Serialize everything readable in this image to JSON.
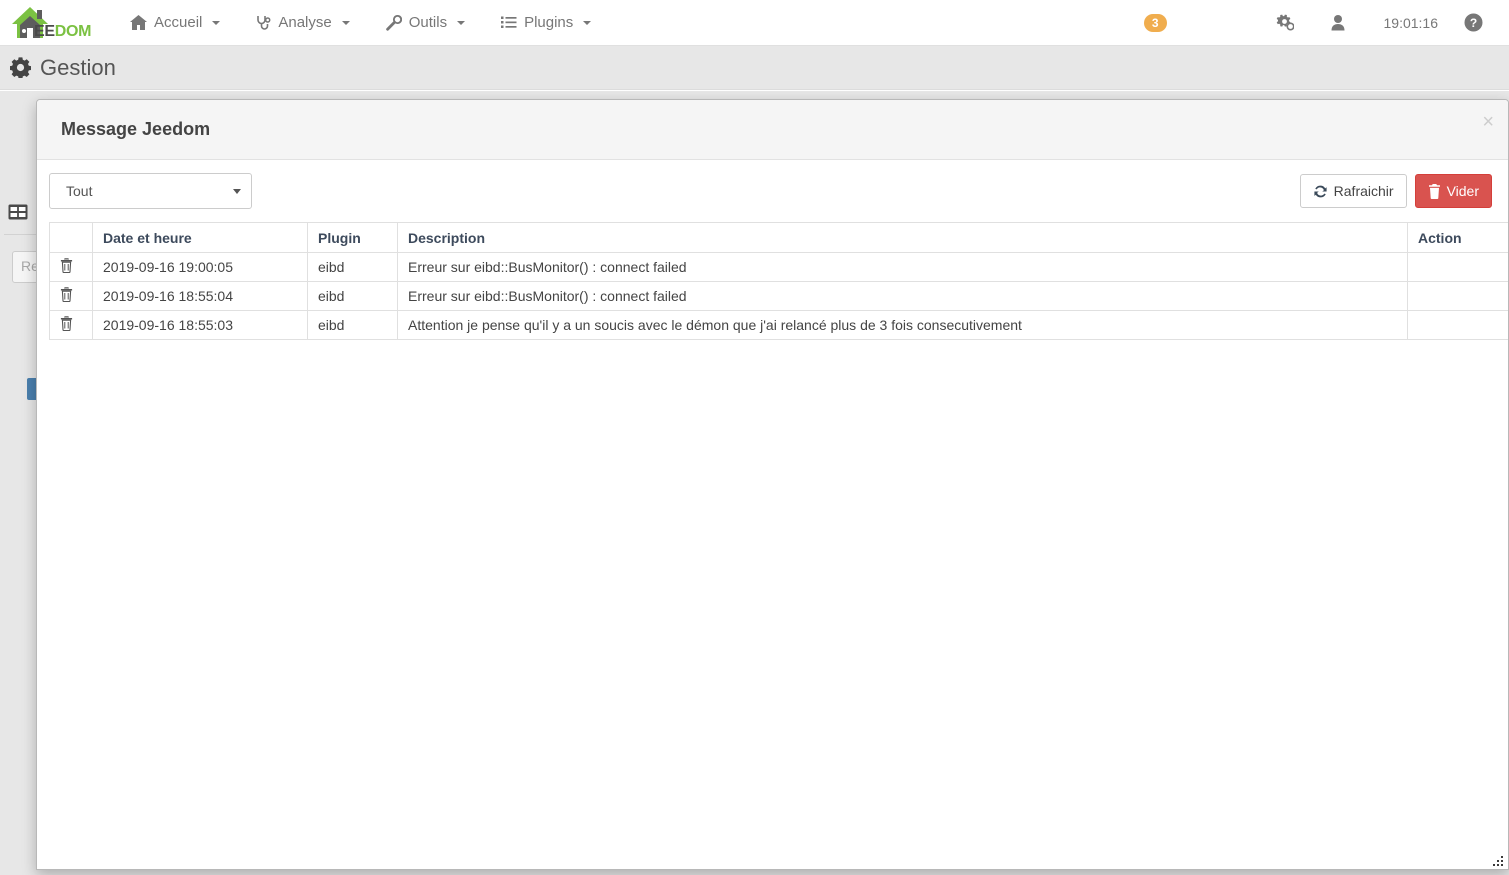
{
  "navbar": {
    "logo": {
      "ee": "EE",
      "dom": "DOM",
      "icon": "jeedom-house-logo"
    },
    "menu": [
      {
        "label": "Accueil",
        "icon": "home-icon",
        "caret": true
      },
      {
        "label": "Analyse",
        "icon": "stethoscope-icon",
        "caret": true
      },
      {
        "label": "Outils",
        "icon": "wrench-icon",
        "caret": true
      },
      {
        "label": "Plugins",
        "icon": "list-ul-icon",
        "caret": true
      }
    ],
    "message_badge": "3",
    "gear_icon": "gears-icon",
    "user_icon": "user-icon",
    "clock": "19:01:16",
    "help_icon": "question-circle-icon"
  },
  "page": {
    "title": "Gestion",
    "title_icon": "cog-icon"
  },
  "background": {
    "grid_icon": "table-grid-icon",
    "search_value": "Re",
    "blue_tab": "panel-handle"
  },
  "modal": {
    "title": "Message Jeedom",
    "close_label": "×",
    "filter": {
      "selected": "Tout",
      "options": [
        "Tout"
      ]
    },
    "buttons": {
      "refresh": {
        "label": "Rafraichir",
        "icon": "refresh-icon"
      },
      "clear": {
        "label": "Vider",
        "icon": "trash-icon",
        "color": "#d9534f"
      }
    },
    "table": {
      "columns": [
        "",
        "Date et heure",
        "Plugin",
        "Description",
        "Action"
      ],
      "rows": [
        {
          "delete_icon": "trash-icon",
          "date": "2019-09-16 19:00:05",
          "plugin": "eibd",
          "description": "Erreur sur eibd::BusMonitor() : connect failed",
          "action": ""
        },
        {
          "delete_icon": "trash-icon",
          "date": "2019-09-16 18:55:04",
          "plugin": "eibd",
          "description": "Erreur sur eibd::BusMonitor() : connect failed",
          "action": ""
        },
        {
          "delete_icon": "trash-icon",
          "date": "2019-09-16 18:55:03",
          "plugin": "eibd",
          "description": "Attention je pense qu'il y a un soucis avec le démon que j'ai relancé plus de 3 fois consecutivement",
          "action": ""
        }
      ]
    },
    "resize_grip": "resize-handle"
  }
}
